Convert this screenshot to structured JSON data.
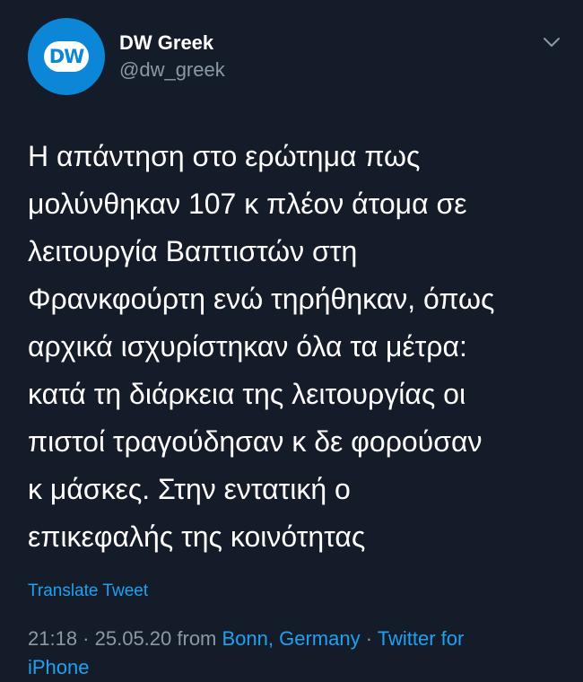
{
  "account": {
    "display_name": "DW Greek",
    "handle": "@dw_greek",
    "avatar_label": "DW"
  },
  "tweet": {
    "lines": [
      "Η απάντηση στο ερώτημα πως",
      "μολύνθηκαν 107 κ πλέον άτομα σε",
      "λειτουργία Βαπτιστών στη",
      "Φρανκφούρτη ενώ τηρήθηκαν, όπως",
      "αρχικά ισχυρίστηκαν όλα τα μέτρα:",
      "κατά τη διάρκεια της λειτουργίας οι",
      "πιστοί τραγούδησαν κ δε φορούσαν",
      "κ μάσκες. Στην εντατική ο",
      "επικεφαλής της κοινότητας"
    ],
    "translate_label": "Translate Tweet",
    "time": "21:18",
    "separator1": " · ",
    "date": "25.05.20",
    "from_word": " from ",
    "location": "Bonn, Germany",
    "separator2": " · ",
    "source_line1": "Twitter for",
    "source_line2": "iPhone"
  },
  "colors": {
    "background": "#151c29",
    "accent": "#1da1f2",
    "secondary_text": "#8b98a5",
    "avatar_blue": "#0c86d6"
  },
  "icons": {
    "menu": "chevron-down-icon"
  }
}
